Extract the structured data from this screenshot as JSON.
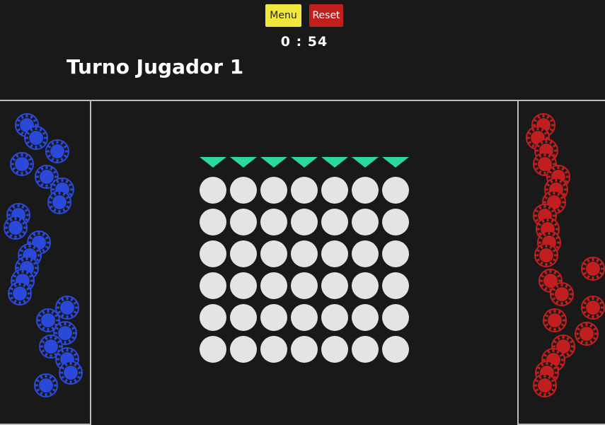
{
  "header": {
    "menu_label": "Menu",
    "reset_label": "Reset",
    "timer": "0 : 54",
    "turn_text": "Turno Jugador 1"
  },
  "colors": {
    "background": "#1a1919",
    "player1": "#2b49d9",
    "player2": "#c11f1f",
    "arrow": "#2ed6a0",
    "empty_cell": "#e4e4e4",
    "menu_button": "#f1e83d",
    "reset_button": "#c11f1f"
  },
  "board": {
    "columns": 7,
    "rows": 6,
    "cells": [
      [
        "empty",
        "empty",
        "empty",
        "empty",
        "empty",
        "empty",
        "empty"
      ],
      [
        "empty",
        "empty",
        "empty",
        "empty",
        "empty",
        "empty",
        "empty"
      ],
      [
        "empty",
        "empty",
        "empty",
        "empty",
        "empty",
        "empty",
        "empty"
      ],
      [
        "empty",
        "empty",
        "empty",
        "empty",
        "empty",
        "empty",
        "empty"
      ],
      [
        "empty",
        "empty",
        "empty",
        "empty",
        "empty",
        "empty",
        "empty"
      ],
      [
        "empty",
        "empty",
        "empty",
        "empty",
        "empty",
        "empty",
        "empty"
      ]
    ]
  },
  "pieces": {
    "player1_count": 21,
    "player2_count": 21
  }
}
